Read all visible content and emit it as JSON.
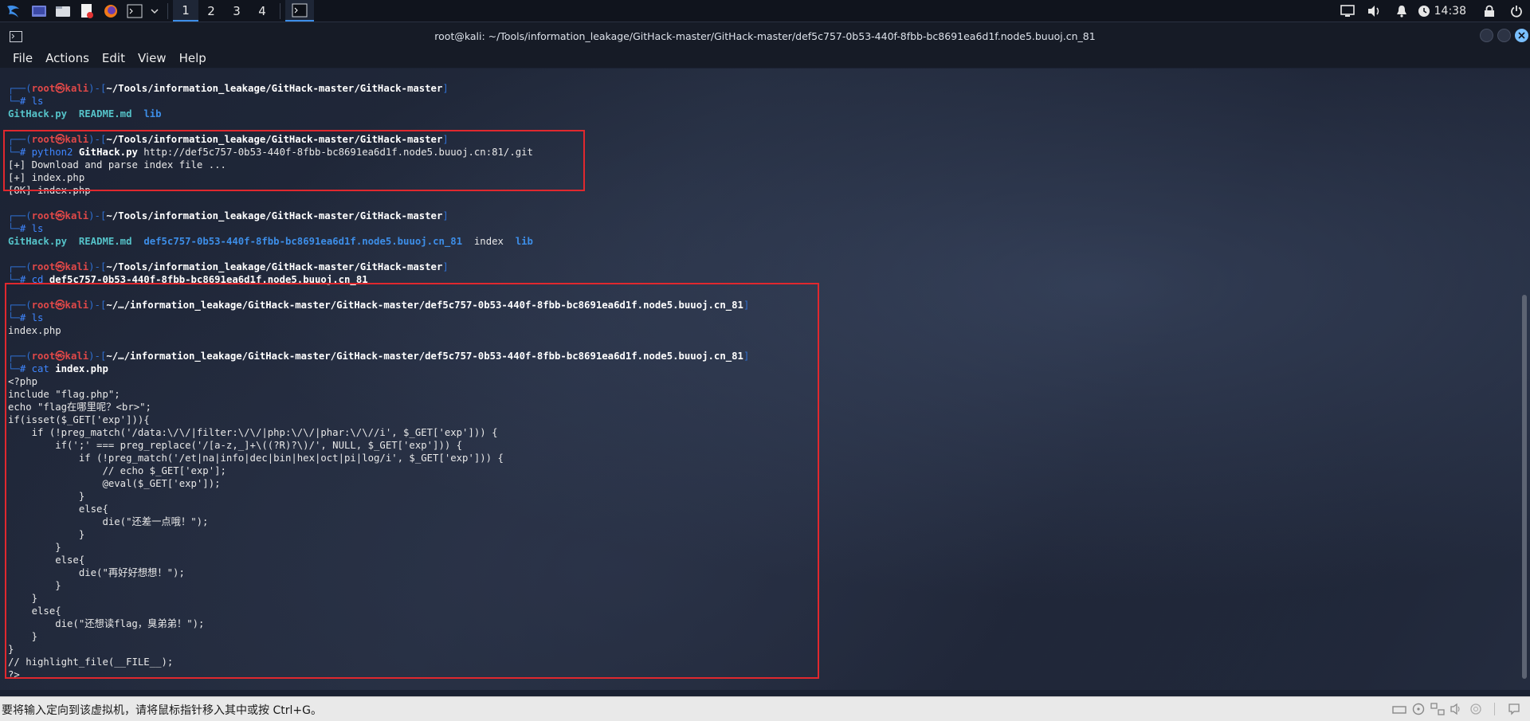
{
  "taskbar": {
    "workspaces": [
      "1",
      "2",
      "3",
      "4"
    ],
    "clock": "14:38"
  },
  "window": {
    "title": "root@kali: ~/Tools/information_leakage/GitHack-master/GitHack-master/def5c757-0b53-440f-8fbb-bc8691ea6d1f.node5.buuoj.cn_81"
  },
  "menu": [
    "File",
    "Actions",
    "Edit",
    "View",
    "Help"
  ],
  "prompt": {
    "box_top_open": "┌──(",
    "user": "root㉿kali",
    "box_mid": ")-[",
    "box_close": "]",
    "box_bottom": "└─",
    "hash": "# "
  },
  "blocks": [
    {
      "path": "~/Tools/information_leakage/GitHack-master/GitHack-master",
      "cmd": "ls",
      "arg": "",
      "output_ls": [
        {
          "name": "GitHack.py",
          "kind": "file"
        },
        {
          "name": "README.md",
          "kind": "file"
        },
        {
          "name": "lib",
          "kind": "dir"
        }
      ]
    },
    {
      "path": "~/Tools/information_leakage/GitHack-master/GitHack-master",
      "cmd": "python2",
      "arg": "GitHack.py",
      "arg_tail": " http://def5c757-0b53-440f-8fbb-bc8691ea6d1f.node5.buuoj.cn:81/.git",
      "output": [
        "[+] Download and parse index file ...",
        "[+] index.php",
        "[OK] index.php"
      ]
    },
    {
      "path": "~/Tools/information_leakage/GitHack-master/GitHack-master",
      "cmd": "ls",
      "arg": "",
      "output_ls": [
        {
          "name": "GitHack.py",
          "kind": "file"
        },
        {
          "name": "README.md",
          "kind": "file"
        },
        {
          "name": "def5c757-0b53-440f-8fbb-bc8691ea6d1f.node5.buuoj.cn_81",
          "kind": "dir"
        },
        {
          "name": "index",
          "kind": "plain"
        },
        {
          "name": "lib",
          "kind": "dir"
        }
      ]
    },
    {
      "path": "~/Tools/information_leakage/GitHack-master/GitHack-master",
      "cmd": "cd",
      "arg": "def5c757-0b53-440f-8fbb-bc8691ea6d1f.node5.buuoj.cn_81"
    },
    {
      "path": "~/…/information_leakage/GitHack-master/GitHack-master/def5c757-0b53-440f-8fbb-bc8691ea6d1f.node5.buuoj.cn_81",
      "cmd": "ls",
      "arg": "",
      "output": [
        "index.php"
      ]
    },
    {
      "path": "~/…/information_leakage/GitHack-master/GitHack-master/def5c757-0b53-440f-8fbb-bc8691ea6d1f.node5.buuoj.cn_81",
      "cmd": "cat",
      "arg": "index.php",
      "output": [
        "<?php",
        "include \"flag.php\";",
        "echo \"flag在哪里呢？<br>\";",
        "if(isset($_GET['exp'])){",
        "    if (!preg_match('/data:\\/\\/|filter:\\/\\/|php:\\/\\/|phar:\\/\\//i', $_GET['exp'])) {",
        "        if(';' === preg_replace('/[a-z,_]+\\((?R)?\\)/', NULL, $_GET['exp'])) {",
        "            if (!preg_match('/et|na|info|dec|bin|hex|oct|pi|log/i', $_GET['exp'])) {",
        "                // echo $_GET['exp'];",
        "                @eval($_GET['exp']);",
        "            }",
        "            else{",
        "                die(\"还差一点哦！\");",
        "            }",
        "        }",
        "        else{",
        "            die(\"再好好想想！\");",
        "        }",
        "    }",
        "    else{",
        "        die(\"还想读flag，臭弟弟！\");",
        "    }",
        "}",
        "// highlight_file(__FILE__);",
        "?>"
      ]
    }
  ],
  "status_bar": {
    "message": "要将输入定向到该虚拟机，请将鼠标指针移入其中或按 Ctrl+G。"
  },
  "colors": {
    "accent": "#3d8ee8",
    "prompt_user": "#e04848",
    "highlight_box": "#e0282e"
  }
}
